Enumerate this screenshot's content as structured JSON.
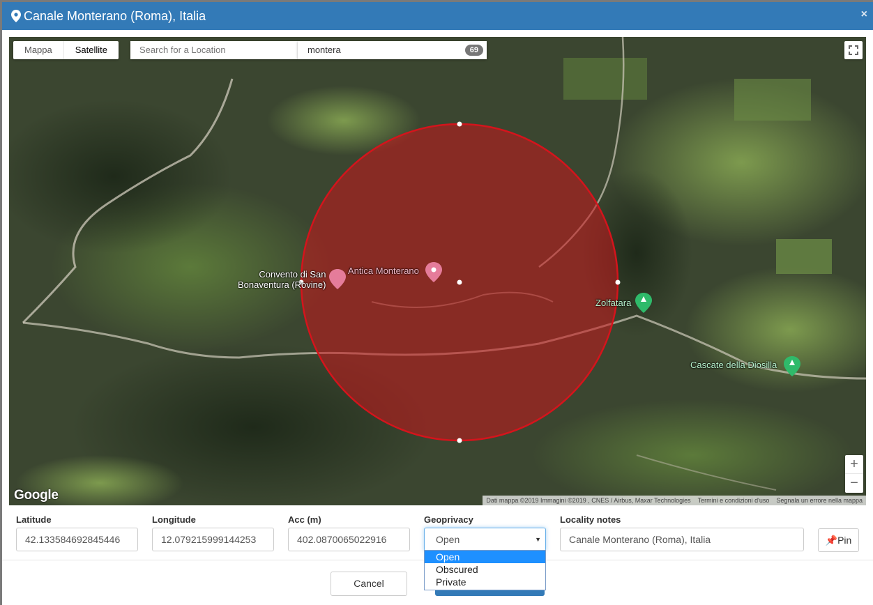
{
  "modal": {
    "title": "Canale Monterano (Roma), Italia",
    "close_label": "×"
  },
  "map": {
    "map_types": [
      "Mappa",
      "Satellite"
    ],
    "active_map_type": "Satellite",
    "search_placeholder": "Search for a Location",
    "query": "montera",
    "result_count": "69",
    "labels": {
      "convento_line1": "Convento di San",
      "convento_line2": "Bonaventura (Rovine)",
      "antica": "Antica Monterano",
      "zolfatara": "Zolfatara",
      "cascate": "Cascate della Diosilla"
    },
    "zoom_in": "+",
    "zoom_out": "−",
    "google_logo": "Google",
    "attribution": {
      "data": "Dati mappa ©2019 Immagini ©2019 , CNES / Airbus, Maxar Technologies",
      "terms": "Termini e condizioni d'uso",
      "report": "Segnala un errore nella mappa"
    },
    "colors": {
      "accuracy_circle": "#c8161c"
    }
  },
  "form": {
    "latitude": {
      "label": "Latitude",
      "value": "42.133584692845446"
    },
    "longitude": {
      "label": "Longitude",
      "value": "12.079215999144253"
    },
    "accuracy": {
      "label": "Acc (m)",
      "value": "402.0870065022916"
    },
    "geoprivacy": {
      "label": "Geoprivacy",
      "value": "Open",
      "options": [
        "Open",
        "Obscured",
        "Private"
      ]
    },
    "locality": {
      "label": "Locality notes",
      "value": "Canale Monterano (Roma), Italia"
    },
    "pin_label": "Pin"
  },
  "footer": {
    "cancel_label": "Cancel"
  },
  "theme": {
    "header_bg": "#337ab7"
  }
}
